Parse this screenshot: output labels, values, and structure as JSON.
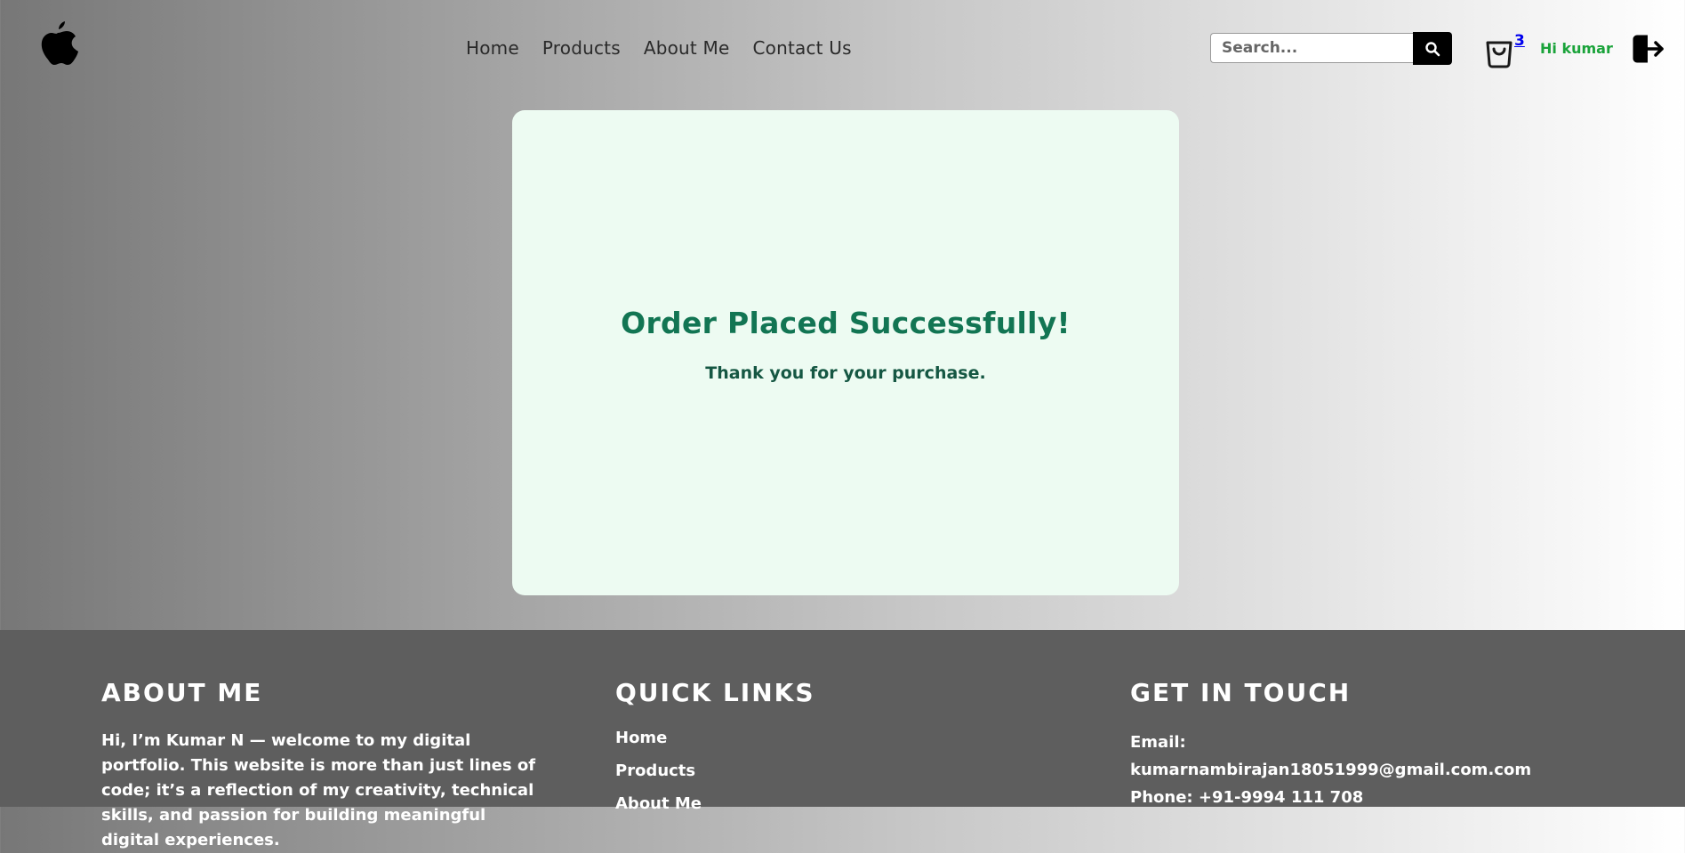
{
  "header": {
    "nav": [
      "Home",
      "Products",
      "About Me",
      "Contact Us"
    ],
    "search": {
      "placeholder": "Search..."
    },
    "cart_count": "3",
    "greeting": "Hi kumar"
  },
  "main": {
    "title": "Order Placed Successfully!",
    "subtitle": "Thank you for your purchase."
  },
  "footer": {
    "about": {
      "title": "ABOUT ME",
      "text": "Hi, I’m Kumar N — welcome to my digital portfolio. This website is more than just lines of code; it’s a reflection of my creativity, technical skills, and passion for building meaningful digital experiences."
    },
    "links": {
      "title": "QUICK LINKS",
      "items": [
        "Home",
        "Products",
        "About Me"
      ]
    },
    "contact": {
      "title": "GET IN TOUCH",
      "email_label": "Email:",
      "email": "kumarnambirajan18051999@gmail.com.com",
      "phone": "Phone: +91-9994 111 708"
    }
  },
  "colors": {
    "card_bg": "#edfbf2",
    "title_green": "#127553",
    "greeting_green": "#1aa33a",
    "footer_bg": "#5e5e5e"
  },
  "icons": [
    "apple-logo-icon",
    "search-icon",
    "shopping-bag-icon",
    "logout-icon"
  ]
}
